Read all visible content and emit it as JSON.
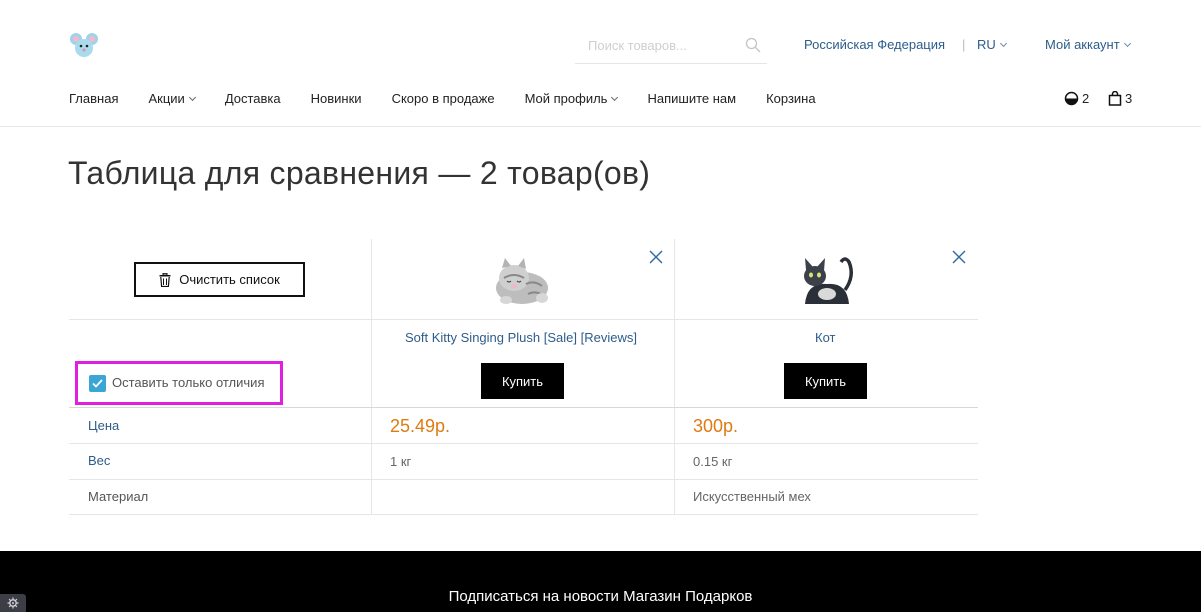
{
  "header": {
    "search_placeholder": "Поиск товаров...",
    "country": "Российская Федерация",
    "separator": "|",
    "language": "RU",
    "account": "Мой аккаунт"
  },
  "nav": {
    "items": [
      {
        "label": "Главная"
      },
      {
        "label": "Акции"
      },
      {
        "label": "Доставка"
      },
      {
        "label": "Новинки"
      },
      {
        "label": "Скоро в продаже"
      },
      {
        "label": "Мой профиль"
      },
      {
        "label": "Напишите нам"
      },
      {
        "label": "Корзина"
      }
    ],
    "compare_count": "2",
    "cart_count": "3"
  },
  "page_title": "Таблица для сравнения — 2 товар(ов)",
  "compare": {
    "clear_label": "Очистить список",
    "only_differences_label": "Оставить только отличия",
    "only_differences_checked": true,
    "buy_label": "Купить",
    "products": [
      {
        "name": "Soft Kitty Singing Plush [Sale] [Reviews]",
        "price": "25.49р.",
        "weight": "1 кг",
        "material": ""
      },
      {
        "name": "Кот",
        "price": "300р.",
        "weight": "0.15 кг",
        "material": "Искусственный мех"
      }
    ],
    "attributes": {
      "price": "Цена",
      "weight": "Вес",
      "material": "Материал"
    }
  },
  "footer": {
    "subscribe_text": "Подписаться на новости Магазин Подарков"
  },
  "colors": {
    "link": "#2d5d8a",
    "price": "#e07a12",
    "highlight": "#e020e0",
    "checkbox": "#3aa6d6"
  }
}
